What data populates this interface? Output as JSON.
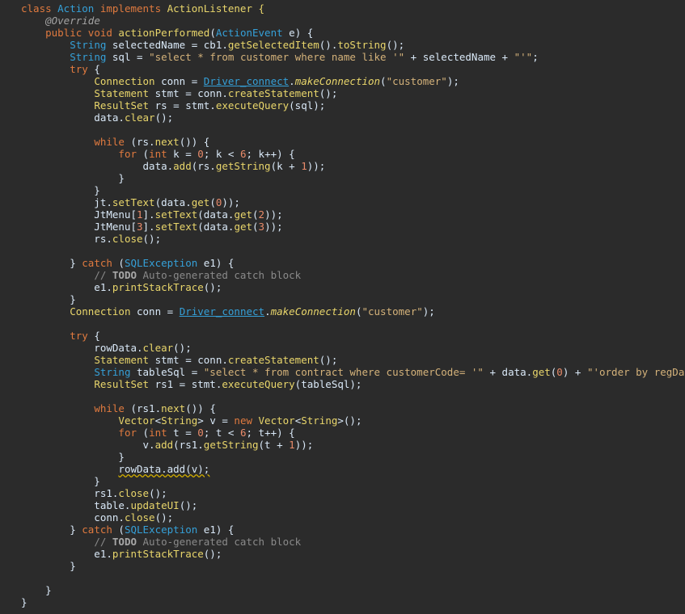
{
  "editor": {
    "lines": [
      [
        {
          "t": "class ",
          "c": "kw"
        },
        {
          "t": "Action",
          "c": "ty"
        },
        {
          "t": " implements ",
          "c": "kw"
        },
        {
          "t": "ActionListener {",
          "c": "cls"
        }
      ],
      [
        {
          "t": "    "
        },
        {
          "t": "@Override",
          "c": "an"
        }
      ],
      [
        {
          "t": "    "
        },
        {
          "t": "public void ",
          "c": "kw"
        },
        {
          "t": "actionPerformed",
          "c": "fn"
        },
        {
          "t": "(",
          "c": ""
        },
        {
          "t": "ActionEvent",
          "c": "ty"
        },
        {
          "t": " e) {",
          "c": ""
        }
      ],
      [
        {
          "t": "        "
        },
        {
          "t": "String",
          "c": "ty"
        },
        {
          "t": " selectedName = cb1."
        },
        {
          "t": "getSelectedItem",
          "c": "fn"
        },
        {
          "t": "()."
        },
        {
          "t": "toString",
          "c": "fn"
        },
        {
          "t": "();"
        }
      ],
      [
        {
          "t": "        "
        },
        {
          "t": "String",
          "c": "ty"
        },
        {
          "t": " sql = "
        },
        {
          "t": "\"select * from customer where name like '\"",
          "c": "str"
        },
        {
          "t": " + selectedName + "
        },
        {
          "t": "\"'\"",
          "c": "str"
        },
        {
          "t": ";"
        }
      ],
      [
        {
          "t": "        "
        },
        {
          "t": "try",
          "c": "kw"
        },
        {
          "t": " {"
        }
      ],
      [
        {
          "t": "            "
        },
        {
          "t": "Connection",
          "c": "cls"
        },
        {
          "t": " conn = "
        },
        {
          "t": "Driver_connect",
          "c": "uline"
        },
        {
          "t": "."
        },
        {
          "t": "makeConnection",
          "c": "it"
        },
        {
          "t": "("
        },
        {
          "t": "\"customer\"",
          "c": "str"
        },
        {
          "t": ");"
        }
      ],
      [
        {
          "t": "            "
        },
        {
          "t": "Statement",
          "c": "cls"
        },
        {
          "t": " stmt = conn."
        },
        {
          "t": "createStatement",
          "c": "fn"
        },
        {
          "t": "();"
        }
      ],
      [
        {
          "t": "            "
        },
        {
          "t": "ResultSet",
          "c": "cls"
        },
        {
          "t": " rs = stmt."
        },
        {
          "t": "executeQuery",
          "c": "fn"
        },
        {
          "t": "(sql);"
        }
      ],
      [
        {
          "t": "            data."
        },
        {
          "t": "clear",
          "c": "fn"
        },
        {
          "t": "();"
        }
      ],
      [
        {
          "t": ""
        }
      ],
      [
        {
          "t": "            "
        },
        {
          "t": "while",
          "c": "kw"
        },
        {
          "t": " (rs."
        },
        {
          "t": "next",
          "c": "fn"
        },
        {
          "t": "()) {"
        }
      ],
      [
        {
          "t": "                "
        },
        {
          "t": "for",
          "c": "kw"
        },
        {
          "t": " ("
        },
        {
          "t": "int",
          "c": "kw"
        },
        {
          "t": " k = "
        },
        {
          "t": "0",
          "c": "num"
        },
        {
          "t": "; k < "
        },
        {
          "t": "6",
          "c": "num"
        },
        {
          "t": "; k++) {"
        }
      ],
      [
        {
          "t": "                    data."
        },
        {
          "t": "add",
          "c": "fn"
        },
        {
          "t": "(rs."
        },
        {
          "t": "getString",
          "c": "fn"
        },
        {
          "t": "(k + "
        },
        {
          "t": "1",
          "c": "num"
        },
        {
          "t": "));"
        }
      ],
      [
        {
          "t": "                }"
        }
      ],
      [
        {
          "t": "            }"
        }
      ],
      [
        {
          "t": "            jt."
        },
        {
          "t": "setText",
          "c": "fn"
        },
        {
          "t": "(data."
        },
        {
          "t": "get",
          "c": "fn"
        },
        {
          "t": "("
        },
        {
          "t": "0",
          "c": "num"
        },
        {
          "t": "));"
        }
      ],
      [
        {
          "t": "            JtMenu["
        },
        {
          "t": "1",
          "c": "num"
        },
        {
          "t": "]."
        },
        {
          "t": "setText",
          "c": "fn"
        },
        {
          "t": "(data."
        },
        {
          "t": "get",
          "c": "fn"
        },
        {
          "t": "("
        },
        {
          "t": "2",
          "c": "num"
        },
        {
          "t": "));"
        }
      ],
      [
        {
          "t": "            JtMenu["
        },
        {
          "t": "3",
          "c": "num"
        },
        {
          "t": "]."
        },
        {
          "t": "setText",
          "c": "fn"
        },
        {
          "t": "(data."
        },
        {
          "t": "get",
          "c": "fn"
        },
        {
          "t": "("
        },
        {
          "t": "3",
          "c": "num"
        },
        {
          "t": "));"
        }
      ],
      [
        {
          "t": "            rs."
        },
        {
          "t": "close",
          "c": "fn"
        },
        {
          "t": "();"
        }
      ],
      [
        {
          "t": ""
        }
      ],
      [
        {
          "t": "        } "
        },
        {
          "t": "catch",
          "c": "kw"
        },
        {
          "t": " ("
        },
        {
          "t": "SQLException",
          "c": "ty"
        },
        {
          "t": " e1) {"
        }
      ],
      [
        {
          "t": "            "
        },
        {
          "t": "// ",
          "c": "cm"
        },
        {
          "t": "TODO",
          "c": "cmk"
        },
        {
          "t": " Auto-generated catch block",
          "c": "cm"
        }
      ],
      [
        {
          "t": "            e1."
        },
        {
          "t": "printStackTrace",
          "c": "fn"
        },
        {
          "t": "();"
        }
      ],
      [
        {
          "t": "        }"
        }
      ],
      [
        {
          "t": "        "
        },
        {
          "t": "Connection",
          "c": "cls"
        },
        {
          "t": " conn = "
        },
        {
          "t": "Driver_connect",
          "c": "uline"
        },
        {
          "t": "."
        },
        {
          "t": "makeConnection",
          "c": "it"
        },
        {
          "t": "("
        },
        {
          "t": "\"customer\"",
          "c": "str"
        },
        {
          "t": ");"
        }
      ],
      [
        {
          "t": ""
        }
      ],
      [
        {
          "t": "        "
        },
        {
          "t": "try",
          "c": "kw"
        },
        {
          "t": " {"
        }
      ],
      [
        {
          "t": "            rowData."
        },
        {
          "t": "clear",
          "c": "fn"
        },
        {
          "t": "();"
        }
      ],
      [
        {
          "t": "            "
        },
        {
          "t": "Statement",
          "c": "cls"
        },
        {
          "t": " stmt = conn."
        },
        {
          "t": "createStatement",
          "c": "fn"
        },
        {
          "t": "();"
        }
      ],
      [
        {
          "t": "            "
        },
        {
          "t": "String",
          "c": "ty"
        },
        {
          "t": " tableSql = "
        },
        {
          "t": "\"select * from contract where customerCode= '\"",
          "c": "str"
        },
        {
          "t": " + data."
        },
        {
          "t": "get",
          "c": "fn"
        },
        {
          "t": "("
        },
        {
          "t": "0",
          "c": "num"
        },
        {
          "t": ") + "
        },
        {
          "t": "\"'order by regData\"",
          "c": "str"
        },
        {
          "t": ";"
        }
      ],
      [
        {
          "t": "            "
        },
        {
          "t": "ResultSet",
          "c": "cls"
        },
        {
          "t": " rs1 = stmt."
        },
        {
          "t": "executeQuery",
          "c": "fn"
        },
        {
          "t": "(tableSql);"
        }
      ],
      [
        {
          "t": ""
        }
      ],
      [
        {
          "t": "            "
        },
        {
          "t": "while",
          "c": "kw"
        },
        {
          "t": " (rs1."
        },
        {
          "t": "next",
          "c": "fn"
        },
        {
          "t": "()) {"
        }
      ],
      [
        {
          "t": "                "
        },
        {
          "t": "Vector",
          "c": "cls"
        },
        {
          "t": "<"
        },
        {
          "t": "String",
          "c": "cls"
        },
        {
          "t": "> v = "
        },
        {
          "t": "new ",
          "c": "kw"
        },
        {
          "t": "Vector",
          "c": "cls"
        },
        {
          "t": "<"
        },
        {
          "t": "String",
          "c": "cls"
        },
        {
          "t": ">();"
        }
      ],
      [
        {
          "t": "                "
        },
        {
          "t": "for",
          "c": "kw"
        },
        {
          "t": " ("
        },
        {
          "t": "int",
          "c": "kw"
        },
        {
          "t": " t = "
        },
        {
          "t": "0",
          "c": "num"
        },
        {
          "t": "; t < "
        },
        {
          "t": "6",
          "c": "num"
        },
        {
          "t": "; t++) {"
        }
      ],
      [
        {
          "t": "                    v."
        },
        {
          "t": "add",
          "c": "fn"
        },
        {
          "t": "(rs1."
        },
        {
          "t": "getString",
          "c": "fn"
        },
        {
          "t": "(t + "
        },
        {
          "t": "1",
          "c": "num"
        },
        {
          "t": "));"
        }
      ],
      [
        {
          "t": "                }"
        }
      ],
      [
        {
          "t": "                "
        },
        {
          "t": "rowData.add(v);",
          "c": "warn"
        }
      ],
      [
        {
          "t": "            }"
        }
      ],
      [
        {
          "t": "            rs1."
        },
        {
          "t": "close",
          "c": "fn"
        },
        {
          "t": "();"
        }
      ],
      [
        {
          "t": "            table."
        },
        {
          "t": "updateUI",
          "c": "fn"
        },
        {
          "t": "();"
        }
      ],
      [
        {
          "t": "            conn."
        },
        {
          "t": "close",
          "c": "fn"
        },
        {
          "t": "();"
        }
      ],
      [
        {
          "t": "        } "
        },
        {
          "t": "catch",
          "c": "kw"
        },
        {
          "t": " ("
        },
        {
          "t": "SQLException",
          "c": "ty"
        },
        {
          "t": " e1) {"
        }
      ],
      [
        {
          "t": "            "
        },
        {
          "t": "// ",
          "c": "cm"
        },
        {
          "t": "TODO",
          "c": "cmk"
        },
        {
          "t": " Auto-generated catch block",
          "c": "cm"
        }
      ],
      [
        {
          "t": "            e1."
        },
        {
          "t": "printStackTrace",
          "c": "fn"
        },
        {
          "t": "();"
        }
      ],
      [
        {
          "t": "        }"
        }
      ],
      [
        {
          "t": ""
        }
      ],
      [
        {
          "t": "    }"
        }
      ],
      [
        {
          "t": "}"
        }
      ]
    ]
  }
}
